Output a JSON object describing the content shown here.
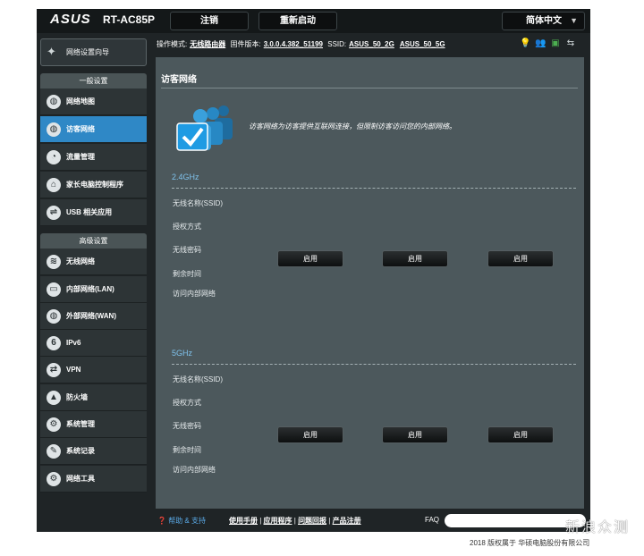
{
  "brand": {
    "logo": "ASUS",
    "model": "RT-AC85P"
  },
  "top_buttons": {
    "logout": "注销",
    "reboot": "重新启动",
    "language": "简体中文"
  },
  "status": {
    "op_mode_label": "操作模式:",
    "op_mode": "无线路由器",
    "firmware_label": "固件版本:",
    "firmware": "3.0.0.4.382_51199",
    "ssid_label": "SSID:",
    "ssid_2g": "ASUS_50_2G",
    "ssid_5g": "ASUS_50_5G"
  },
  "quick_setup": "网络设置向导",
  "sidebar": {
    "general_title": "一般设置",
    "general_items": [
      {
        "label": "网络地图",
        "icon": "globe-icon"
      },
      {
        "label": "访客网络",
        "icon": "globe-icon"
      },
      {
        "label": "流量管理",
        "icon": "gauge-icon"
      },
      {
        "label": "家长电脑控制程序",
        "icon": "lock-icon"
      },
      {
        "label": "USB 相关应用",
        "icon": "usb-icon"
      }
    ],
    "advanced_title": "高级设置",
    "advanced_items": [
      {
        "label": "无线网络",
        "icon": "wifi-icon"
      },
      {
        "label": "内部网络(LAN)",
        "icon": "lan-icon"
      },
      {
        "label": "外部网络(WAN)",
        "icon": "wan-icon"
      },
      {
        "label": "IPv6",
        "icon": "ipv6-icon"
      },
      {
        "label": "VPN",
        "icon": "vpn-icon"
      },
      {
        "label": "防火墙",
        "icon": "firewall-icon"
      },
      {
        "label": "系统管理",
        "icon": "gear-icon"
      },
      {
        "label": "系统记录",
        "icon": "log-icon"
      },
      {
        "label": "网络工具",
        "icon": "tools-icon"
      }
    ]
  },
  "main": {
    "title": "访客网络",
    "description": "访客网络为访客提供互联网连接，但限制访客访问您的内部网络。",
    "bands": [
      {
        "name": "2.4GHz",
        "fields": [
          "无线名称(SSID)",
          "授权方式",
          "无线密码",
          "剩余时间",
          "访问内部网络"
        ],
        "buttons": [
          "启用",
          "启用",
          "启用"
        ]
      },
      {
        "name": "5GHz",
        "fields": [
          "无线名称(SSID)",
          "授权方式",
          "无线密码",
          "剩余时间",
          "访问内部网络"
        ],
        "buttons": [
          "启用",
          "启用",
          "启用"
        ]
      }
    ]
  },
  "footer": {
    "help": "帮助 & 支持",
    "links": [
      "使用手册",
      "应用程序",
      "问题回报",
      "产品注册"
    ],
    "faq": "FAQ",
    "copyright": "2018 版权属于 华硕电脑股份有限公司",
    "watermark": "新浪众测"
  },
  "colors": {
    "accent": "#2f88c6",
    "band_label": "#7fc2ec",
    "panel": "#4c585c"
  }
}
